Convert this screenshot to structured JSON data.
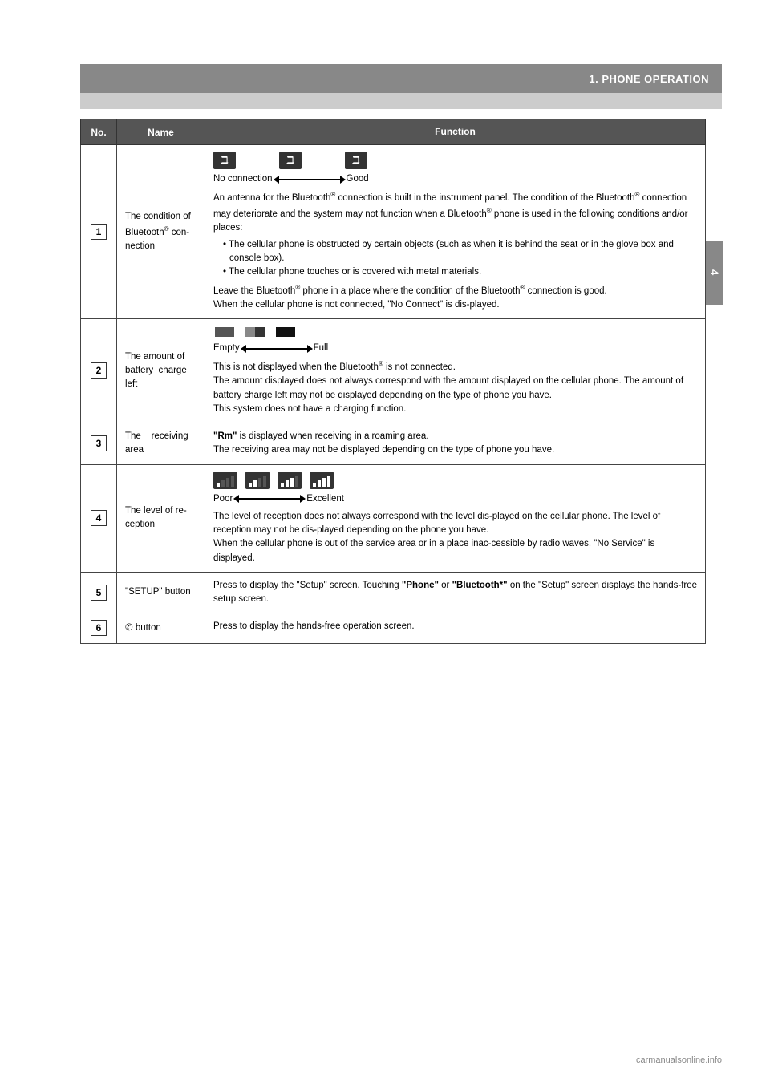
{
  "header": {
    "title": "1. PHONE OPERATION",
    "bar_bg": "#888888"
  },
  "sidebar_tab": "4",
  "table": {
    "col_no": "No.",
    "col_name": "Name",
    "col_function": "Function",
    "rows": [
      {
        "no": "1",
        "name": "The condition of Bluetooth® con-nection",
        "function_summary": "No connection → Good. An antenna for the Bluetooth® connection is built in the instrument panel. The condition of the Bluetooth® connection may deteriorate and the system may not function when a Bluetooth® phone is used in the following conditions and/or places:",
        "bullets": [
          "The cellular phone is obstructed by certain objects (such as when it is behind the seat or in the glove box and console box).",
          "The cellular phone touches or is covered with metal materials."
        ],
        "function_extra": "Leave the Bluetooth® phone in a place where the condition of the Bluetooth® connection is good.\nWhen the cellular phone is not connected, \"No Connect\" is displayed."
      },
      {
        "no": "2",
        "name": "The amount of battery charge left",
        "function_summary": "Empty ← → Full\nThis is not displayed when the Bluetooth® is not connected.\nThe amount displayed does not always correspond with the amount displayed on the cellular phone. The amount of battery charge left may not be displayed depending on the type of phone you have.\nThis system does not have a charging function."
      },
      {
        "no": "3",
        "name": "The receiving area",
        "function_summary": "\"Rm\" is displayed when receiving in a roaming area.\nThe receiving area may not be displayed depending on the type of phone you have."
      },
      {
        "no": "4",
        "name": "The level of re-ception",
        "function_summary": "Poor ← → Excellent\nThe level of reception does not always correspond with the level displayed on the cellular phone. The level of reception may not be displayed depending on the phone you have.\nWhen the cellular phone is out of the service area or in a place inaccessible by radio waves, \"No Service\" is displayed."
      },
      {
        "no": "5",
        "name": "\"SETUP\" button",
        "function_summary": "Press to display the \"Setup\" screen. Touching \"Phone\" or \"Bluetooth*\" on the \"Setup\" screen displays the hands-free setup screen."
      },
      {
        "no": "6",
        "name": "☎ button",
        "function_summary": "Press to display the hands-free operation screen."
      }
    ]
  },
  "watermark": "carmanualsonline.info"
}
